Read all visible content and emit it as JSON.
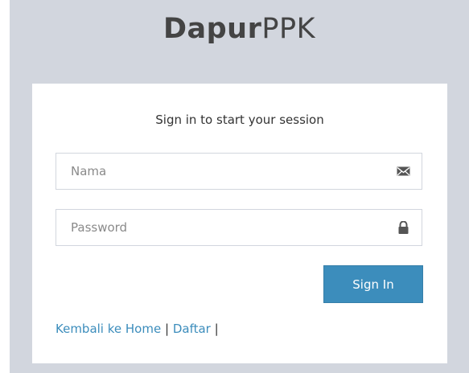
{
  "brand": {
    "bold": "Dapur",
    "light": "PPK"
  },
  "login": {
    "message": "Sign in to start your session",
    "name_placeholder": "Nama",
    "password_placeholder": "Password",
    "signin_label": "Sign In"
  },
  "links": {
    "home": "Kembali ke Home",
    "sep1": "|",
    "register": "Daftar",
    "sep2": "|"
  },
  "icons": {
    "name_field": "envelope-icon",
    "password_field": "lock-icon"
  },
  "colors": {
    "background": "#d2d6de",
    "primary": "#3c8dbc",
    "link": "#3c8dbc"
  }
}
